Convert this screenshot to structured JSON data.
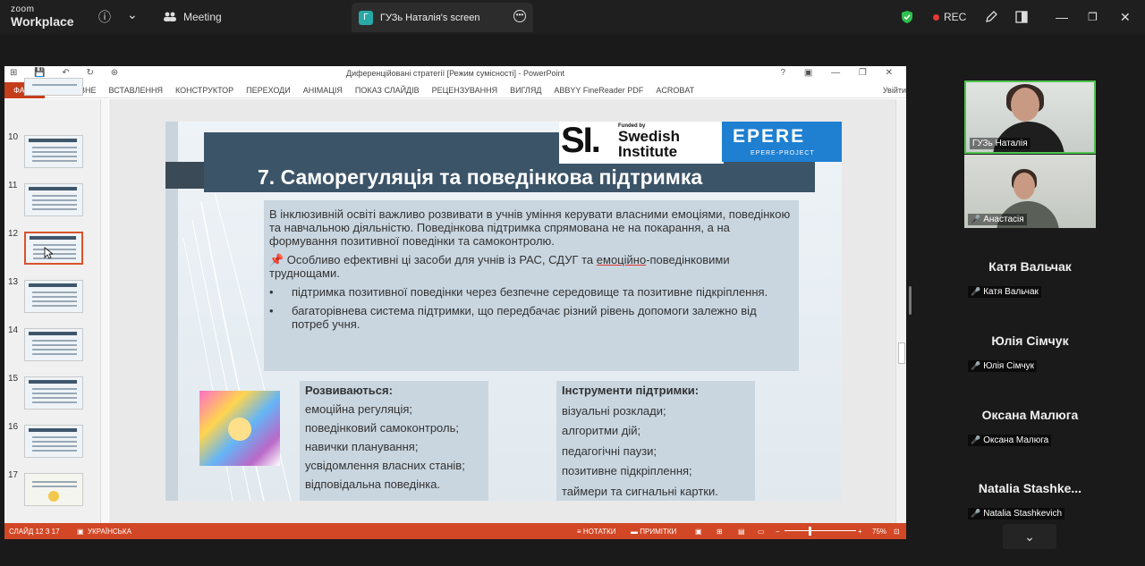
{
  "zoom": {
    "logo_line1": "zoom",
    "logo_line2": "Workplace",
    "info_icon": "ⓘ",
    "chevron": "⌄",
    "meeting_label": "Meeting",
    "share_badge": "Г",
    "share_label": "ГУЗь Наталія's screen",
    "rec_label": "REC",
    "colors": {
      "rec": "#e53935",
      "shield": "#2fbf4f",
      "bar": "#1f1f1f"
    }
  },
  "ppt": {
    "title": "Диференційовані стратегії [Режим сумісності] - PowerPoint",
    "window_controls": "?  ▣  —  ❐  ✕",
    "qat": "⊞ 💾 ↶ ↻ ⊛",
    "ribbon": {
      "file": "ФАЙЛ",
      "tabs": [
        "ОСНОВНЕ",
        "ВСТАВЛЕННЯ",
        "КОНСТРУКТОР",
        "ПЕРЕХОДИ",
        "АНІМАЦІЯ",
        "ПОКАЗ СЛАЙДІВ",
        "РЕЦЕНЗУВАННЯ",
        "ВИГЛЯД",
        "ABBYY FineReader PDF",
        "ACROBAT"
      ],
      "user": "Увійти"
    },
    "thumbs": [
      "10",
      "11",
      "12",
      "13",
      "14",
      "15",
      "16",
      "17"
    ],
    "status": {
      "slide": "СЛАЙД 12 З 17",
      "lang": "УКРАЇНСЬКА",
      "notes": "НОТАТКИ",
      "comments": "ПРИМІТКИ",
      "zoom": "75%"
    },
    "colors": {
      "accent": "#d24726"
    }
  },
  "slide": {
    "logo_si": "SI.",
    "logo_funded": "Funded by",
    "logo_swedish": "Swedish",
    "logo_institute": "Institute",
    "logo_epere": "EPERE",
    "logo_epere_sub": "EPERE-PROJECT",
    "title": "7. Саморегуляція та поведінкова підтримка",
    "p1": "В інклюзивній освіті важливо розвивати в учнів уміння керувати власними емоціями, поведінкою та навчальною діяльністю. Поведінкова підтримка спрямована не на покарання, а на формування позитивної поведінки та самоконтролю.",
    "p2_prefix": "📌 Особливо ефективні ці засоби для учнів із РАС, СДУГ та ",
    "p2_underlined": "емоційно",
    "p2_suffix": "-поведінковими труднощами.",
    "bullet": "•",
    "b1": "підтримка позитивної поведінки через безпечне середовище та позитивне підкріплення.",
    "b2": "багаторівнева система підтримки, що передбачає різний рівень допомоги залежно від потреб учня.",
    "develop_title": "Розвиваються:",
    "develop": [
      "емоційна регуляція;",
      "поведінковий самоконтроль;",
      "навички планування;",
      "усвідомлення власних станів;",
      "відповідальна поведінка."
    ],
    "tools_title": "Інструменти підтримки:",
    "tools": [
      "візуальні розклади;",
      "алгоритми дій;",
      "педагогічні паузи;",
      "позитивне підкріплення;",
      "таймери та сигнальні картки."
    ]
  },
  "participants": {
    "video": [
      {
        "name": "ГУЗь Наталія",
        "muted": false
      },
      {
        "name": "Анастасія",
        "muted": true
      }
    ],
    "names": [
      {
        "display": "Катя Вальчак",
        "label": "Катя Вальчак"
      },
      {
        "display": "Юлія Сімчук",
        "label": "Юлія Сімчук"
      },
      {
        "display": "Оксана Малюга",
        "label": "Оксана Малюга"
      },
      {
        "display": "Natalia  Stashke...",
        "label": "Natalia Stashkevich"
      }
    ],
    "mic_off_icon": "🎤",
    "more_icon": "⌄"
  }
}
